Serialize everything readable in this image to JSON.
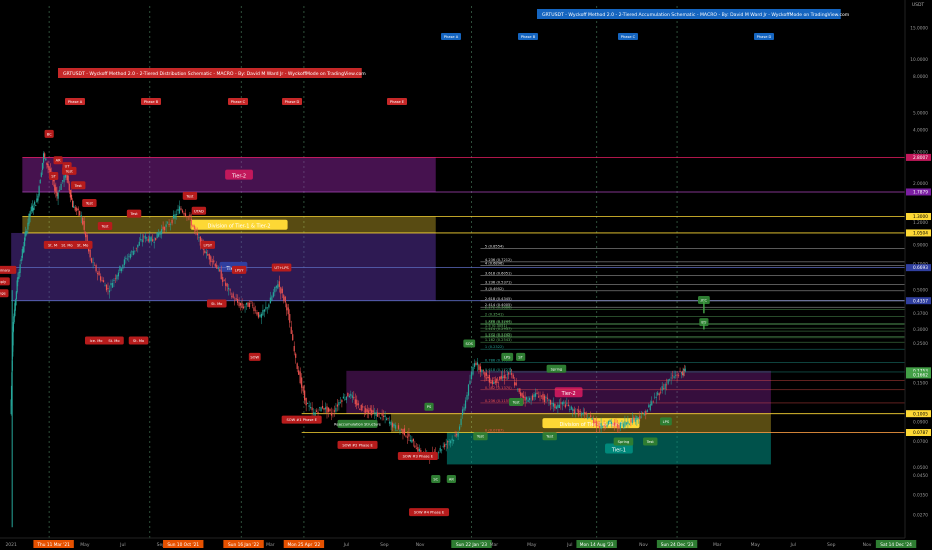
{
  "chart_data": {
    "type": "candlestick",
    "symbol_label": "USDT",
    "log_scale": true,
    "grid": false,
    "ylim": [
      0.02,
      20
    ],
    "xlim": [
      2020.95,
      2025.0
    ],
    "y_ticks": [
      "15.0000",
      "10.0000",
      "8.0000",
      "5.0000",
      "4.0000",
      "3.0000",
      "2.0000",
      "1.2000",
      "0.9000",
      "0.7000",
      "0.5000",
      "0.3700",
      "0.3000",
      "0.2500",
      "0.1500",
      "0.1000",
      "0.0900",
      "0.0700",
      "0.0500",
      "0.0450",
      "0.0350",
      "0.0270"
    ],
    "y_tick_values": [
      15,
      10,
      8,
      5,
      4,
      3,
      2,
      1.2,
      0.9,
      0.7,
      0.5,
      0.37,
      0.3,
      0.25,
      0.15,
      0.1,
      0.09,
      0.07,
      0.05,
      0.045,
      0.035,
      0.027
    ],
    "price_tags": [
      {
        "text": "2.8007",
        "value": 2.8007,
        "color": "#c2185b"
      },
      {
        "text": "1.7879",
        "value": 1.7879,
        "color": "#7b1fa2"
      },
      {
        "text": "1.3000",
        "value": 1.3,
        "color": "#fdd835"
      },
      {
        "text": "1.0504",
        "value": 1.0504,
        "color": "#fdd835"
      },
      {
        "text": "0.6693",
        "value": 0.6693,
        "color": "#303f9f"
      },
      {
        "text": "0.4357",
        "value": 0.4357,
        "color": "#303f9f"
      },
      {
        "text": "0.1753",
        "value": 0.1753,
        "color": "#43a047"
      },
      {
        "text": "0.1662",
        "value": 0.1662,
        "color": "#43a047"
      },
      {
        "text": "0.1005",
        "value": 0.1005,
        "color": "#fdd835"
      },
      {
        "text": "0.0787",
        "value": 0.0787,
        "color": "#fdd835"
      }
    ],
    "x_ticks": [
      {
        "text": "2021",
        "x": 2021.0,
        "hl": false
      },
      {
        "text": "Thu 11 Mar '21",
        "x": 2021.19,
        "hl": true
      },
      {
        "text": "May",
        "x": 2021.33,
        "hl": false
      },
      {
        "text": "Jul",
        "x": 2021.5,
        "hl": false
      },
      {
        "text": "Sep",
        "x": 2021.67,
        "hl": false
      },
      {
        "text": "Sun 10 Oct '21",
        "x": 2021.77,
        "hl": true
      },
      {
        "text": "2022",
        "x": 2022.0,
        "hl": false
      },
      {
        "text": "Sun 16 Jan '22",
        "x": 2022.04,
        "hl": true
      },
      {
        "text": "Mar",
        "x": 2022.16,
        "hl": false
      },
      {
        "text": "Mon 25 Apr '22",
        "x": 2022.31,
        "hl": true
      },
      {
        "text": "Jul",
        "x": 2022.5,
        "hl": false
      },
      {
        "text": "Sep",
        "x": 2022.67,
        "hl": false
      },
      {
        "text": "Nov",
        "x": 2022.83,
        "hl": false
      },
      {
        "text": "Sun 22 Jan '23",
        "x": 2023.06,
        "hl": true
      },
      {
        "text": "Mar",
        "x": 2023.16,
        "hl": false
      },
      {
        "text": "May",
        "x": 2023.33,
        "hl": false
      },
      {
        "text": "Jul",
        "x": 2023.5,
        "hl": false
      },
      {
        "text": "Mon 14 Aug '23",
        "x": 2023.62,
        "hl": true
      },
      {
        "text": "Nov",
        "x": 2023.83,
        "hl": false
      },
      {
        "text": "Sun 24 Dec '23",
        "x": 2023.98,
        "hl": true
      },
      {
        "text": "Mar",
        "x": 2024.16,
        "hl": false
      },
      {
        "text": "May",
        "x": 2024.33,
        "hl": false
      },
      {
        "text": "Jul",
        "x": 2024.5,
        "hl": false
      },
      {
        "text": "Sep",
        "x": 2024.67,
        "hl": false
      },
      {
        "text": "Nov",
        "x": 2024.83,
        "hl": false
      },
      {
        "text": "Sat 14 Dec '24",
        "x": 2024.96,
        "hl": true
      },
      {
        "text": "Mar",
        "x": 2025.16,
        "hl": false
      }
    ],
    "titles": {
      "distribution": "GRTUSDT - Wyckoff Method 2.0 - 2-Tiered Distribution Schematic - MACRO - By: David M Ward Jr - WyckoffMode on TradingView.com",
      "accumulation": "GRTUSDT - Wyckoff Method 2.0 - 2-Tiered Accumulation Schematic - MACRO - By: David M Ward Jr - WyckoffMode on TradingView.com"
    },
    "dist_phases": [
      "Phase A",
      "Phase B",
      "Phase C",
      "Phase D",
      "Phase E"
    ],
    "acc_phases": [
      "Phase A",
      "Phase B",
      "Phase C",
      "Phase D"
    ],
    "zones": [
      {
        "label": "Tier-2",
        "from": 1.7879,
        "to": 2.8007,
        "x0": 2021.05,
        "x1": 2022.9,
        "color": "rgba(156,39,176,0.45)",
        "label_color": "#c2185b"
      },
      {
        "label": "Division of Tier-1 & Tier-2",
        "from": 1.05,
        "to": 1.3,
        "x0": 2021.05,
        "x1": 2022.9,
        "color": "rgba(253,216,53,0.35)",
        "label_color": "#fdd835"
      },
      {
        "label": "Tier-1",
        "from": 0.4357,
        "to": 1.05,
        "x0": 2021.0,
        "x1": 2022.9,
        "color": "rgba(103,58,183,0.45)",
        "label_color": "#303f9f"
      },
      {
        "label": "Tier-2",
        "from": 0.1005,
        "to": 0.1753,
        "x0": 2022.5,
        "x1": 2024.4,
        "color": "rgba(156,39,176,0.35)",
        "label_color": "#c2185b"
      },
      {
        "label": "Division of Tier-1 & Tier-2",
        "from": 0.0787,
        "to": 0.1005,
        "x0": 2022.7,
        "x1": 2024.4,
        "color": "rgba(253,216,53,0.35)",
        "label_color": "#fdd835"
      },
      {
        "label": "Tier-1",
        "from": 0.052,
        "to": 0.0787,
        "x0": 2022.95,
        "x1": 2024.4,
        "color": "rgba(0,150,136,0.55)",
        "label_color": "#00897b"
      }
    ],
    "fib_levels": [
      {
        "text": "5 (0.8554)",
        "value": 0.8554
      },
      {
        "text": "4.236 (0.7212)",
        "value": 0.7212
      },
      {
        "text": "4 (0.6896)",
        "value": 0.6896
      },
      {
        "text": "3.618 (0.6051)",
        "value": 0.6051
      },
      {
        "text": "3.236 (0.5371)",
        "value": 0.5371
      },
      {
        "text": "3 (0.4952)",
        "value": 0.4952
      },
      {
        "text": "2.618 (0.4345)",
        "value": 0.4345
      },
      {
        "text": "2.414 (0.4005)",
        "value": 0.4005
      },
      {
        "text": "2.272 (0.3886)",
        "value": 0.3886
      },
      {
        "text": "2 (0.3541)",
        "value": 0.3541
      },
      {
        "text": "1.786 (0.3247)",
        "value": 0.3247
      },
      {
        "text": "1.618 (0.3205)",
        "value": 0.3205
      },
      {
        "text": "1.5 (0.3051)",
        "value": 0.3051
      },
      {
        "text": "1.414 (0.2937)",
        "value": 0.2937
      },
      {
        "text": "1.272 (0.2745)",
        "value": 0.2745
      },
      {
        "text": "1.236 (0.2690)",
        "value": 0.269
      },
      {
        "text": "1.162 (0.2543)",
        "value": 0.2543
      },
      {
        "text": "1 (0.2322)",
        "value": 0.2322
      },
      {
        "text": "0.786 (0.1959)",
        "value": 0.1959
      },
      {
        "text": "0.618 (0.1727)",
        "value": 0.1727
      },
      {
        "text": "0.5 (0.1545)",
        "value": 0.1545
      },
      {
        "text": "0.382 (0.1370)",
        "value": 0.137
      },
      {
        "text": "0.236 (0.1155)",
        "value": 0.1155
      },
      {
        "text": "0 (0.0787)",
        "value": 0.0787
      }
    ],
    "wyckoff_events": [
      {
        "text": "BC",
        "x": 2021.17,
        "y": 3.8,
        "color": "#b71c1c"
      },
      {
        "text": "AR",
        "x": 2021.21,
        "y": 2.7,
        "color": "#b71c1c"
      },
      {
        "text": "Test",
        "x": 2021.26,
        "y": 2.35,
        "color": "#b71c1c"
      },
      {
        "text": "Test",
        "x": 2021.3,
        "y": 1.95,
        "color": "#b71c1c"
      },
      {
        "text": "UT",
        "x": 2021.25,
        "y": 2.5,
        "color": "#b71c1c"
      },
      {
        "text": "ST",
        "x": 2021.19,
        "y": 2.2,
        "color": "#b71c1c"
      },
      {
        "text": "Test",
        "x": 2021.35,
        "y": 1.55,
        "color": "#b71c1c"
      },
      {
        "text": "Test",
        "x": 2021.42,
        "y": 1.15,
        "color": "#b71c1c"
      },
      {
        "text": "Test",
        "x": 2021.55,
        "y": 1.35,
        "color": "#b71c1c"
      },
      {
        "text": "Test",
        "x": 2021.8,
        "y": 1.7,
        "color": "#b71c1c"
      },
      {
        "text": "UTAD",
        "x": 2021.84,
        "y": 1.4,
        "color": "#b71c1c"
      },
      {
        "text": "LPSY",
        "x": 2021.88,
        "y": 0.9,
        "color": "#b71c1c"
      },
      {
        "text": "LPSY",
        "x": 2022.02,
        "y": 0.65,
        "color": "#b71c1c"
      },
      {
        "text": "UT+LPS",
        "x": 2022.21,
        "y": 0.67,
        "color": "#b71c1c"
      },
      {
        "text": "St. Mo",
        "x": 2021.19,
        "y": 0.9,
        "color": "#b71c1c"
      },
      {
        "text": "St. Mo",
        "x": 2021.25,
        "y": 0.9,
        "color": "#b71c1c"
      },
      {
        "text": "St. Mo",
        "x": 2021.32,
        "y": 0.9,
        "color": "#b71c1c"
      },
      {
        "text": "Ice. Mo",
        "x": 2021.38,
        "y": 0.26,
        "color": "#b71c1c"
      },
      {
        "text": "St. Mo",
        "x": 2021.46,
        "y": 0.26,
        "color": "#b71c1c"
      },
      {
        "text": "St. Mo",
        "x": 2021.57,
        "y": 0.26,
        "color": "#b71c1c"
      },
      {
        "text": "St. Mo",
        "x": 2021.92,
        "y": 0.42,
        "color": "#b71c1c"
      },
      {
        "text": "SOW",
        "x": 2022.09,
        "y": 0.21,
        "color": "#b71c1c"
      },
      {
        "text": "SOW #1 Phase E",
        "x": 2022.3,
        "y": 0.093,
        "color": "#b71c1c"
      },
      {
        "text": "SOW #2 Phase E",
        "x": 2022.55,
        "y": 0.067,
        "color": "#b71c1c"
      },
      {
        "text": "SOW #3 Phase E",
        "x": 2022.82,
        "y": 0.058,
        "color": "#b71c1c"
      },
      {
        "text": "SOW #4 Phase E",
        "x": 2022.87,
        "y": 0.028,
        "color": "#b71c1c"
      },
      {
        "text": "Preliminary",
        "x": 2020.95,
        "y": 0.65,
        "color": "#b71c1c"
      },
      {
        "text": "Supply",
        "x": 2020.95,
        "y": 0.56,
        "color": "#b71c1c"
      },
      {
        "text": "Range",
        "x": 2020.95,
        "y": 0.48,
        "color": "#b71c1c"
      },
      {
        "text": "PS",
        "x": 2022.87,
        "y": 0.11,
        "color": "#2e7d32"
      },
      {
        "text": "SC",
        "x": 2022.9,
        "y": 0.043,
        "color": "#2e7d32"
      },
      {
        "text": "AR",
        "x": 2022.97,
        "y": 0.043,
        "color": "#2e7d32"
      },
      {
        "text": "Reaccumulation Structure",
        "x": 2022.55,
        "y": 0.088,
        "color": "#2e7d32"
      },
      {
        "text": "SOS",
        "x": 2023.05,
        "y": 0.25,
        "color": "#2e7d32"
      },
      {
        "text": "LPS",
        "x": 2023.22,
        "y": 0.21,
        "color": "#2e7d32"
      },
      {
        "text": "ST",
        "x": 2023.28,
        "y": 0.21,
        "color": "#2e7d32"
      },
      {
        "text": "Spring",
        "x": 2023.44,
        "y": 0.18,
        "color": "#2e7d32"
      },
      {
        "text": "Test",
        "x": 2023.26,
        "y": 0.117,
        "color": "#2e7d32"
      },
      {
        "text": "Test",
        "x": 2023.1,
        "y": 0.075,
        "color": "#2e7d32"
      },
      {
        "text": "Test",
        "x": 2023.41,
        "y": 0.075,
        "color": "#2e7d32"
      },
      {
        "text": "Spring",
        "x": 2023.74,
        "y": 0.07,
        "color": "#2e7d32"
      },
      {
        "text": "Test",
        "x": 2023.86,
        "y": 0.07,
        "color": "#2e7d32"
      },
      {
        "text": "LPS",
        "x": 2023.93,
        "y": 0.091,
        "color": "#2e7d32"
      },
      {
        "text": "JOC",
        "x": 2024.1,
        "y": 0.44,
        "color": "#2e7d32"
      },
      {
        "text": "BU",
        "x": 2024.1,
        "y": 0.33,
        "color": "#2e7d32"
      }
    ]
  }
}
